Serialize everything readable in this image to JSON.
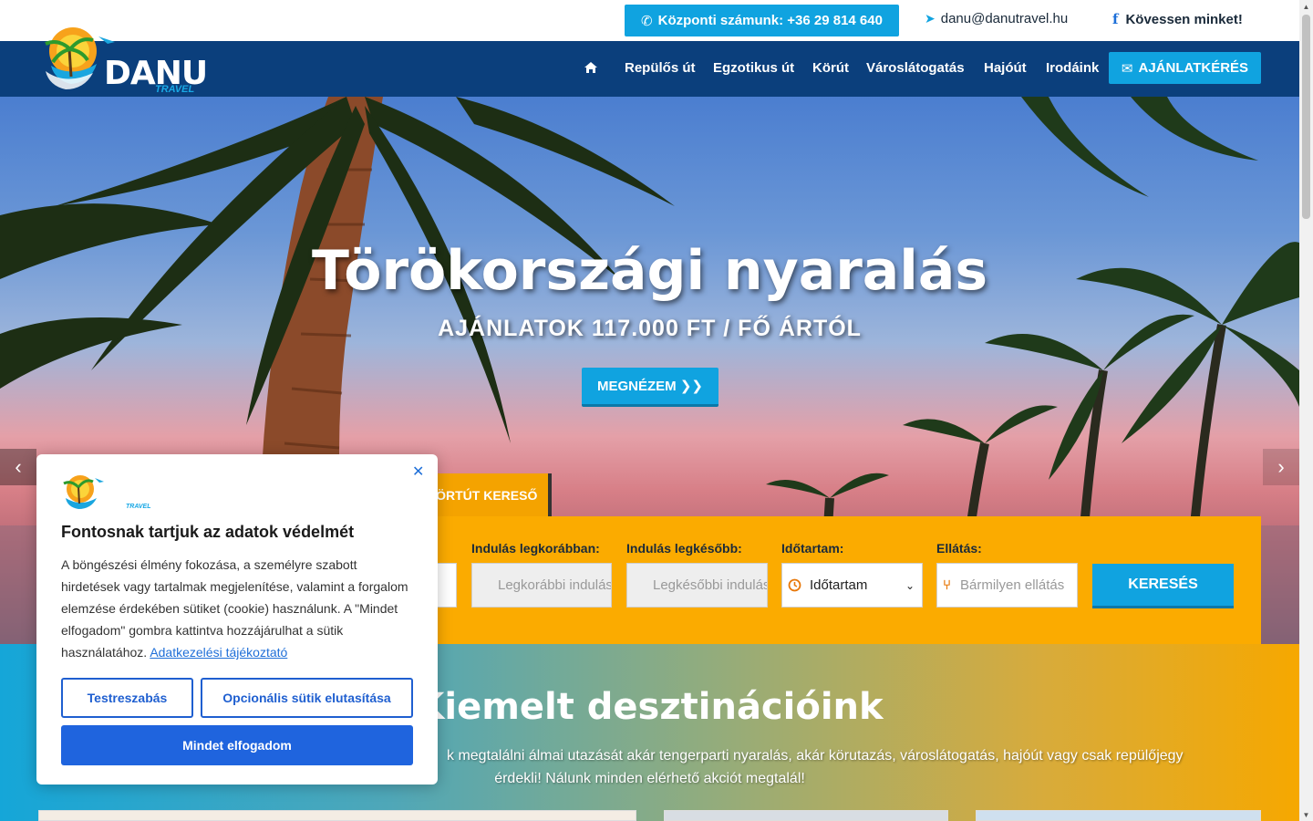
{
  "topbar": {
    "phone": "Központi számunk: +36 29 814 640",
    "email": "danu@danutravel.hu",
    "follow": "Kövessen minket!"
  },
  "logo": {
    "name": "DANU",
    "sub": "TRAVEL"
  },
  "nav": {
    "items": [
      "Repülős út",
      "Egzotikus út",
      "Körút",
      "Városlátogatás",
      "Hajóút",
      "Irodáink"
    ],
    "cta": "AJÁNLATKÉRÉS"
  },
  "hero": {
    "title": "Törökországi nyaralás",
    "subtitle": "AJÁNLATOK 117.000 FT / FŐ ÁRTÓL",
    "button": "MEGNÉZEM ❯❯"
  },
  "search": {
    "tab": "KÖRTÚT KERESŐ",
    "labels": {
      "earliest": "Indulás legkorábban:",
      "latest": "Indulás legkésőbb:",
      "duration": "Időtartam:",
      "board": "Ellátás:"
    },
    "placeholders": {
      "earliest": "Legkorábbi indulás",
      "latest": "Legkésőbbi indulás",
      "board": "Bármilyen ellátás"
    },
    "duration_value": "Időtartam",
    "button": "KERESÉS"
  },
  "section": {
    "title": "Kiemelt desztinációink",
    "text_line1": "k megtalálni álmai utazását akár tengerparti nyaralás, akár körutazás, városlátogatás, hajóút vagy csak repülőjegy",
    "text_line2": "érdekli! Nálunk minden elérhető akciót megtalál!"
  },
  "cookie": {
    "title": "Fontosnak tartjuk az adatok védelmét",
    "text": "A böngészési élmény fokozása, a személyre szabott hirdetések vagy tartalmak megjelenítése, valamint a forgalom elemzése érdekében sütiket (cookie) használunk. A \"Mindet elfogadom\" gombra kattintva hozzájárulhat a sütik használatához.",
    "link": "Adatkezelési tájékoztató",
    "customize": "Testreszabás",
    "reject": "Opcionális sütik elutasítása",
    "accept": "Mindet elfogadom",
    "logo_sub": "TRAVEL"
  },
  "colors": {
    "navy": "#0b3f7c",
    "accent": "#10a3e0",
    "orange": "#fbab00",
    "cookie_blue": "#1f64de"
  }
}
